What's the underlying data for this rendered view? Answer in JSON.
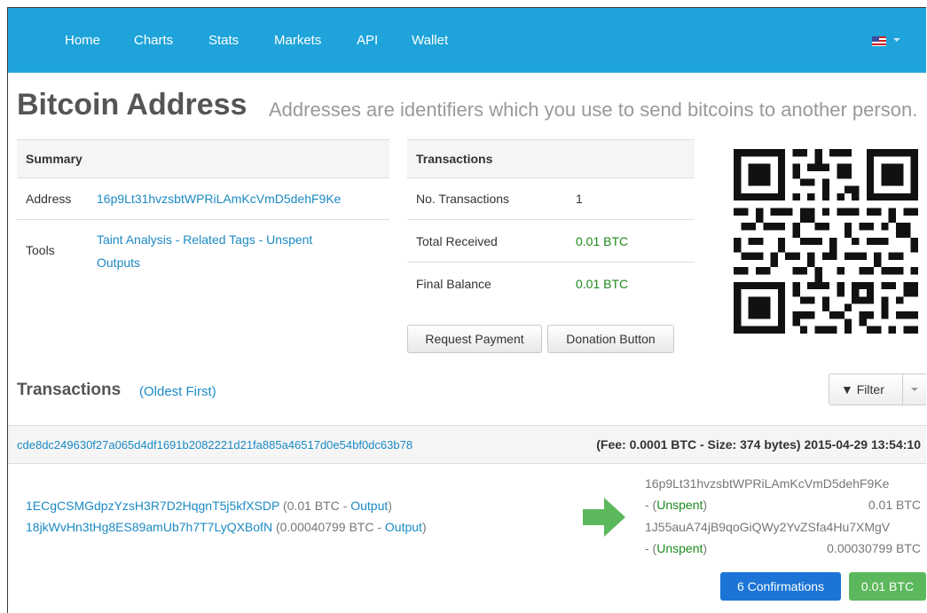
{
  "nav": {
    "items": [
      "Home",
      "Charts",
      "Stats",
      "Markets",
      "API",
      "Wallet"
    ]
  },
  "header": {
    "title": "Bitcoin Address",
    "subtitle": "Addresses are identifiers which you use to send bitcoins to another person."
  },
  "summary": {
    "heading": "Summary",
    "address_label": "Address",
    "address_value": "16p9Lt31hvzsbtWPRiLAmKcVmD5dehF9Ke",
    "tools_label": "Tools",
    "tools_line1": "Taint Analysis - Related Tags - Unspent",
    "tools_line2": "Outputs"
  },
  "transactions_box": {
    "heading": "Transactions",
    "rows": [
      {
        "label": "No. Transactions",
        "value": "1"
      },
      {
        "label": "Total Received",
        "value": "0.01 BTC"
      },
      {
        "label": "Final Balance",
        "value": "0.01 BTC"
      }
    ],
    "request_payment": "Request Payment",
    "donation_button": "Donation Button"
  },
  "tx_section": {
    "title": "Transactions",
    "order_link": "(Oldest First)",
    "filter_label": "Filter"
  },
  "tx": {
    "hash": "cde8dc249630f27a065d4df1691b2082221d21fa885a46517d0e54bf0dc63b78",
    "meta": "(Fee: 0.0001 BTC - Size: 374 bytes) 2015-04-29 13:54:10",
    "inputs": [
      {
        "address": "1ECgCSMGdpzYzsH3R7D2HqgnT5j5kfXSDP",
        "amount": "(0.01 BTC - ",
        "link": "Output",
        "close": ")"
      },
      {
        "address": "18jkWvHn3tHg8ES89amUb7h7T7LyQXBofN",
        "amount": "(0.00040799 BTC - ",
        "link": "Output",
        "close": ")"
      }
    ],
    "outputs": [
      {
        "address": "16p9Lt31hvzsbtWPRiLAmKcVmD5dehF9Ke",
        "dash": "- (",
        "status": "Unspent",
        "close": ")",
        "value": "0.01 BTC"
      },
      {
        "address": "1J55auA74jB9qoGiQWy2YvZSfa4Hu7XMgV",
        "dash": "- (",
        "status": "Unspent",
        "close": ")",
        "value": "0.00030799 BTC"
      }
    ],
    "confirmations": "6 Confirmations",
    "total": "0.01 BTC"
  },
  "colors": {
    "navbar": "#1ea3db",
    "link": "#1c8ac4",
    "btc_green": "#1e8a1e",
    "confirm_badge": "#1b74d6",
    "total_badge": "#5cb85c"
  },
  "icons": [
    "us-flag-icon",
    "chevron-down-icon",
    "filter-icon",
    "arrow-right-icon",
    "qr-code-image"
  ]
}
